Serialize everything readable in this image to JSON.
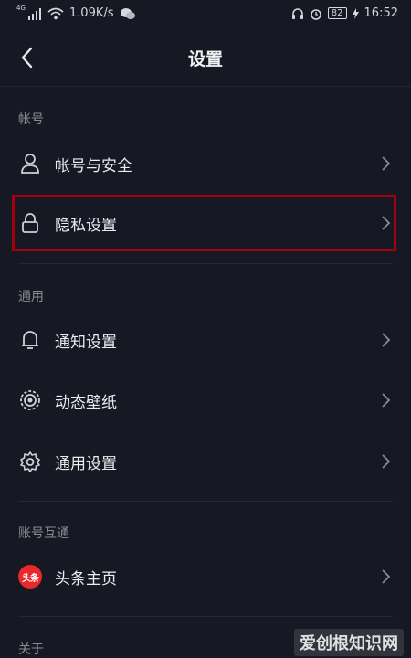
{
  "status_bar": {
    "network_tag": "4G",
    "speed": "1.09K/s",
    "battery": "82",
    "time": "16:52"
  },
  "header": {
    "title": "设置"
  },
  "sections": {
    "account": {
      "label": "帐号"
    },
    "general": {
      "label": "通用"
    },
    "linked": {
      "label": "账号互通"
    },
    "about": {
      "label": "关于"
    }
  },
  "items": {
    "account_security": "帐号与安全",
    "privacy": "隐私设置",
    "notifications": "通知设置",
    "live_wallpaper": "动态壁纸",
    "general_settings": "通用设置",
    "toutiao_home": "头条主页"
  },
  "toutiao_badge": "头条",
  "watermark": "爱创根知识网",
  "colors": {
    "background": "#161823",
    "highlight_border": "#a5000d",
    "toutiao_red": "#e8282b"
  }
}
